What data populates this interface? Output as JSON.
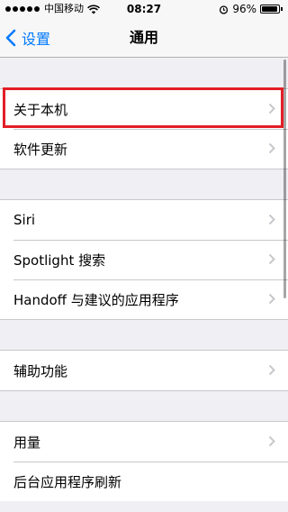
{
  "status_bar": {
    "carrier": "中国移动",
    "time": "08:27",
    "battery_percent": "96%",
    "battery_level": 0.96,
    "icons": [
      "signal-icon",
      "wifi-icon",
      "alarm-icon",
      "battery-icon"
    ]
  },
  "nav": {
    "back_label": "设置",
    "title": "通用"
  },
  "groups": [
    {
      "items": [
        "关于本机",
        "软件更新"
      ]
    },
    {
      "items": [
        "Siri",
        "Spotlight 搜索",
        "Handoff 与建议的应用程序"
      ]
    },
    {
      "items": [
        "辅助功能"
      ]
    },
    {
      "items": [
        "用量",
        "后台应用程序刷新"
      ]
    }
  ],
  "colors": {
    "accent": "#007aff",
    "highlight": "#e21e26",
    "background": "#efeff4"
  }
}
